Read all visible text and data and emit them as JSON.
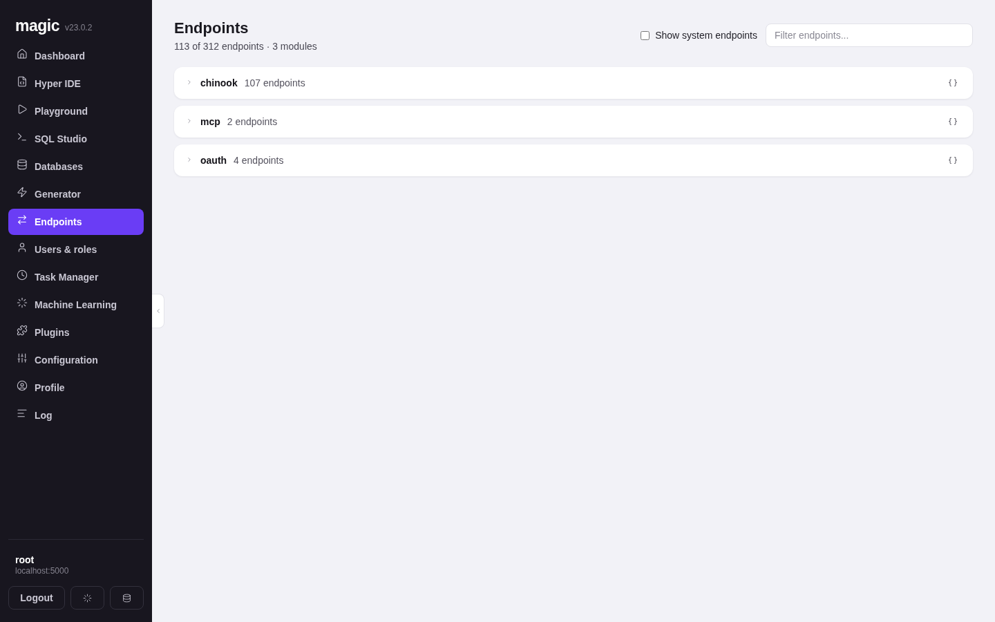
{
  "sidebar": {
    "logo": "magic",
    "version": "v23.0.2",
    "items": [
      {
        "label": "Dashboard",
        "selected": false
      },
      {
        "label": "Hyper IDE",
        "selected": false
      },
      {
        "label": "Playground",
        "selected": false
      },
      {
        "label": "SQL Studio",
        "selected": false
      },
      {
        "label": "Databases",
        "selected": false
      },
      {
        "label": "Generator",
        "selected": false
      },
      {
        "label": "Endpoints",
        "selected": true
      },
      {
        "label": "Users & roles",
        "selected": false
      },
      {
        "label": "Task Manager",
        "selected": false
      },
      {
        "label": "Machine Learning",
        "selected": false
      },
      {
        "label": "Plugins",
        "selected": false
      },
      {
        "label": "Configuration",
        "selected": false
      },
      {
        "label": "Profile",
        "selected": false
      },
      {
        "label": "Log",
        "selected": false
      }
    ],
    "user": {
      "name": "root",
      "host": "localhost:5000"
    },
    "logout": "Logout"
  },
  "page": {
    "title": "Endpoints",
    "summary": "113 of 312 endpoints · 3 modules",
    "system_toggle": {
      "label": "Show system endpoints",
      "checked": false
    },
    "filter": {
      "placeholder": "Filter endpoints..."
    }
  },
  "modules": [
    {
      "name": "chinook",
      "count": "107 endpoints",
      "expanded": false,
      "code_glyph": "{}"
    },
    {
      "name": "mcp",
      "count": "2 endpoints",
      "expanded": false,
      "code_glyph": "{}"
    },
    {
      "name": "oauth",
      "count": "4 endpoints",
      "expanded": false,
      "code_glyph": "{}"
    }
  ]
}
